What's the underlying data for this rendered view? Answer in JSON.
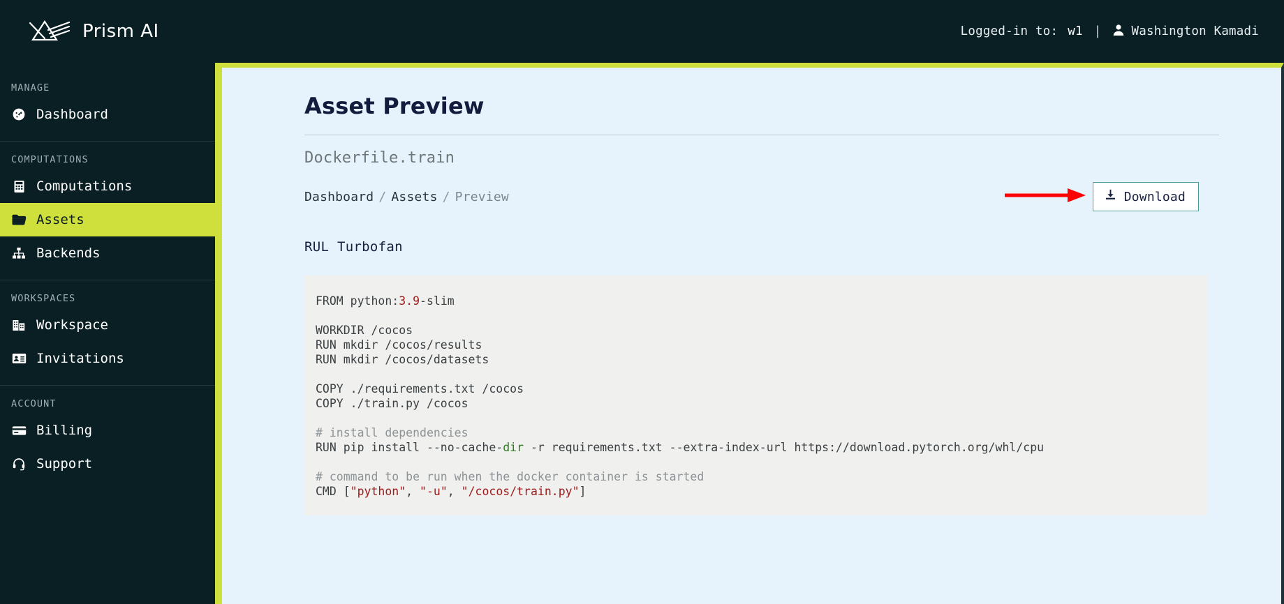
{
  "brand": {
    "name": "Prism AI",
    "logo_icon": "prism-logo-icon"
  },
  "topbar": {
    "logged_in_label": "Logged-in to:",
    "workspace": "w1",
    "separator": "|",
    "user_name": "Washington Kamadi",
    "user_icon": "user-avatar-icon"
  },
  "sidebar": {
    "groups": [
      {
        "label": "MANAGE",
        "items": [
          {
            "label": "Dashboard",
            "icon": "gauge-icon",
            "active": false
          }
        ]
      },
      {
        "label": "COMPUTATIONS",
        "items": [
          {
            "label": "Computations",
            "icon": "calculator-icon",
            "active": false
          },
          {
            "label": "Assets",
            "icon": "folder-icon",
            "active": true
          },
          {
            "label": "Backends",
            "icon": "sitemap-icon",
            "active": false
          }
        ]
      },
      {
        "label": "WORKSPACES",
        "items": [
          {
            "label": "Workspace",
            "icon": "building-icon",
            "active": false
          },
          {
            "label": "Invitations",
            "icon": "id-card-icon",
            "active": false
          }
        ]
      },
      {
        "label": "ACCOUNT",
        "items": [
          {
            "label": "Billing",
            "icon": "credit-card-icon",
            "active": false
          },
          {
            "label": "Support",
            "icon": "headset-icon",
            "active": false
          }
        ]
      }
    ]
  },
  "main": {
    "page_title": "Asset Preview",
    "file_name": "Dockerfile.train",
    "breadcrumb": {
      "items": [
        "Dashboard",
        "Assets",
        "Preview"
      ],
      "separator": "/"
    },
    "download_button": {
      "label": "Download",
      "icon": "download-icon"
    },
    "annotation_arrow": "red-arrow-pointer",
    "asset_name": "RUL Turbofan",
    "code": {
      "language": "dockerfile",
      "lines": [
        "FROM python:3.9-slim",
        "",
        "WORKDIR /cocos",
        "RUN mkdir /cocos/results",
        "RUN mkdir /cocos/datasets",
        "",
        "COPY ./requirements.txt /cocos",
        "COPY ./train.py /cocos",
        "",
        "# install dependencies",
        "RUN pip install --no-cache-dir -r requirements.txt --extra-index-url https://download.pytorch.org/whl/cpu",
        "",
        "# command to be run when the docker container is started",
        "CMD [\"python\", \"-u\", \"/cocos/train.py\"]"
      ]
    }
  },
  "colors": {
    "sidebar_bg": "#091f24",
    "accent_green": "#cfe03c",
    "content_bg": "#e6f3fc",
    "code_bg": "#f0f0ee",
    "button_border": "#4b9f9b",
    "arrow_red": "#ff0000",
    "title_navy": "#131c3d"
  }
}
